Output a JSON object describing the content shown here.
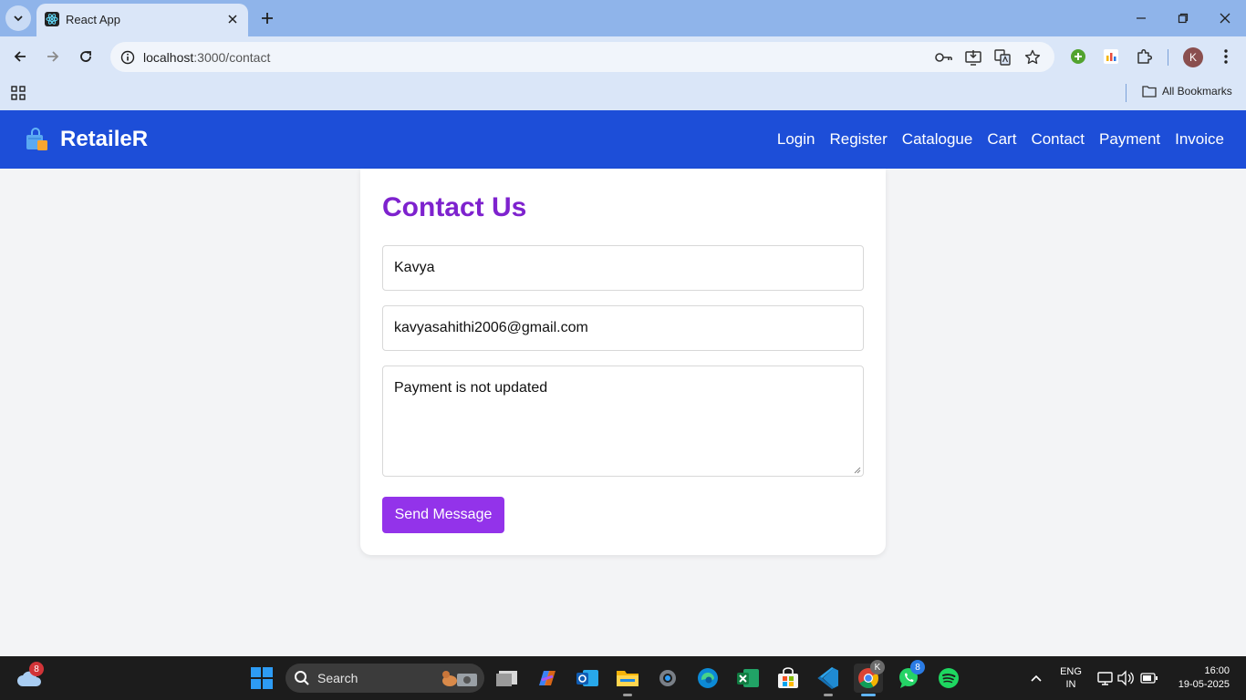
{
  "browser": {
    "tab_title": "React App",
    "url_host": "localhost",
    "url_path": ":3000/contact",
    "profile_initial": "K",
    "all_bookmarks": "All Bookmarks"
  },
  "site": {
    "brand": "RetaileR",
    "nav": [
      "Login",
      "Register",
      "Catalogue",
      "Cart",
      "Contact",
      "Payment",
      "Invoice"
    ],
    "accent": "#1d4ed8"
  },
  "contact": {
    "heading": "Contact Us",
    "name_value": "Kavya",
    "email_value": "kavyasahithi2006@gmail.com",
    "message_value": "Payment is not updated",
    "send_label": "Send Message",
    "heading_color": "#7e22ce",
    "button_color": "#9333ea"
  },
  "taskbar": {
    "weather_badge": "8",
    "search_label": "Search",
    "chrome_badge": "K",
    "whatsapp_badge": "8",
    "lang_line1": "ENG",
    "lang_line2": "IN",
    "time": "16:00",
    "date": "19-05-2025"
  }
}
